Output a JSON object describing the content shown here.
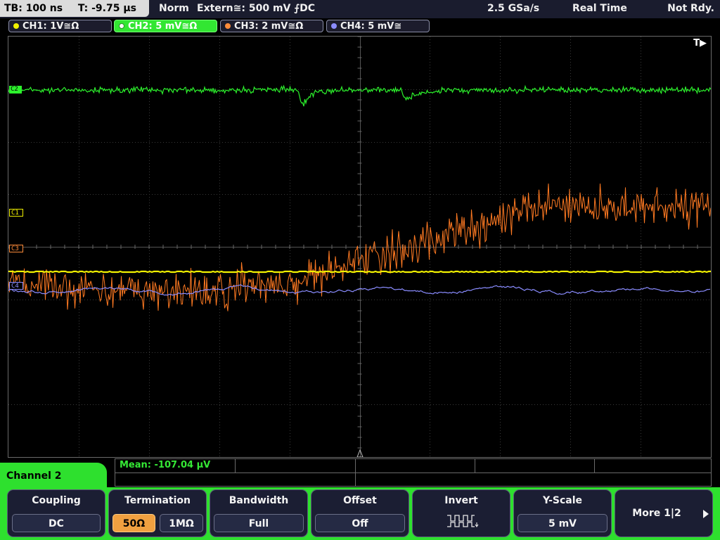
{
  "topbar": {
    "timebase": "TB: 100 ns",
    "trigger_time": "T: -9.75 µs",
    "mode": "Norm",
    "trigger": "Extern≅: 500 mV ⨍DC",
    "sample_rate": "2.5 GSa/s",
    "acq_mode": "Real Time",
    "status": "Not Rdy."
  },
  "channels": [
    {
      "label": "CH1: 1V≅Ω",
      "color": "#f0f000",
      "active": false
    },
    {
      "label": "CH2: 5 mV≅Ω",
      "color": "#33ff33",
      "active": true
    },
    {
      "label": "CH3: 2 mV≅Ω",
      "color": "#ff8c3a",
      "active": false
    },
    {
      "label": "CH4: 5 mV≅",
      "color": "#8c8cff",
      "active": false
    }
  ],
  "screen": {
    "trigger_flag": "T▶",
    "markers": {
      "c2": "C2",
      "c1": "C1",
      "c3": "C3",
      "c4": "C4"
    }
  },
  "measurement": {
    "mean": "Mean: -107.04 µV"
  },
  "menu": {
    "title": "Channel 2",
    "coupling": {
      "title": "Coupling",
      "value": "DC"
    },
    "termination": {
      "title": "Termination",
      "options": [
        "50Ω",
        "1MΩ"
      ],
      "selected": "50Ω"
    },
    "bandwidth": {
      "title": "Bandwidth",
      "value": "Full"
    },
    "offset": {
      "title": "Offset",
      "value": "Off"
    },
    "invert": {
      "title": "Invert",
      "icon": "invert-waveform-icon"
    },
    "yscale": {
      "title": "Y-Scale",
      "value": "5 mV"
    },
    "more": {
      "label": "More 1|2",
      "icon": "arrow-right-icon"
    }
  }
}
